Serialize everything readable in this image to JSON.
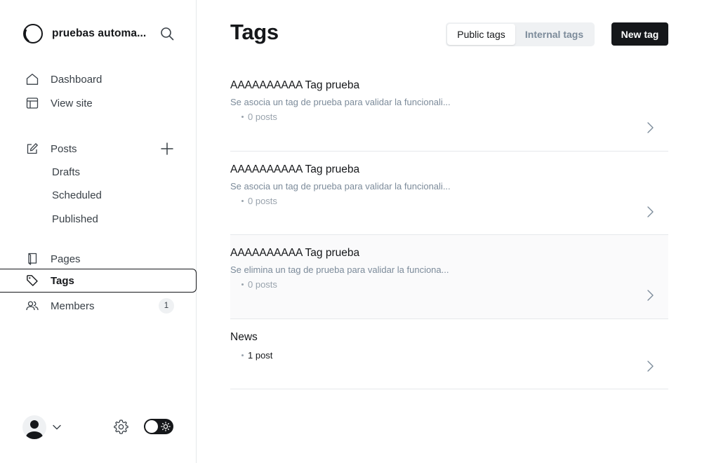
{
  "sidebar": {
    "site_name": "pruebas automa...",
    "nav": {
      "dashboard": "Dashboard",
      "view_site": "View site",
      "posts": "Posts",
      "drafts": "Drafts",
      "scheduled": "Scheduled",
      "published": "Published",
      "pages": "Pages",
      "tags": "Tags",
      "members": "Members",
      "members_count": "1"
    },
    "active_item": "tags",
    "icons": [
      "site-logo-icon",
      "search-icon",
      "home-icon",
      "view-site-icon",
      "posts-pencil-icon",
      "plus-icon",
      "pages-icon",
      "tag-icon",
      "members-icon",
      "user-avatar-icon",
      "chevron-down-icon",
      "gear-icon",
      "sun-icon"
    ]
  },
  "header": {
    "title": "Tags",
    "tabs": [
      {
        "label": "Public tags",
        "selected": true
      },
      {
        "label": "Internal tags",
        "selected": false
      }
    ],
    "new_tag_label": "New tag"
  },
  "tags": [
    {
      "name": "AAAAAAAAAA Tag prueba",
      "description": "Se asocia un tag de prueba para validar la funcionali...",
      "count": "0 posts"
    },
    {
      "name": "AAAAAAAAAA Tag prueba",
      "description": "Se asocia un tag de prueba para validar la funcionali...",
      "count": "0 posts"
    },
    {
      "name": "AAAAAAAAAA Tag prueba",
      "description": "Se elimina un tag de prueba para validar la funciona...",
      "count": "0 posts"
    },
    {
      "name": "News",
      "description": "",
      "count": "1 post"
    }
  ],
  "colors": {
    "text_primary": "#15171a",
    "text_muted": "#7c8b9a",
    "border": "#e6e8eb",
    "button_dark": "#15171a",
    "segment_bg": "#eff1f3"
  }
}
